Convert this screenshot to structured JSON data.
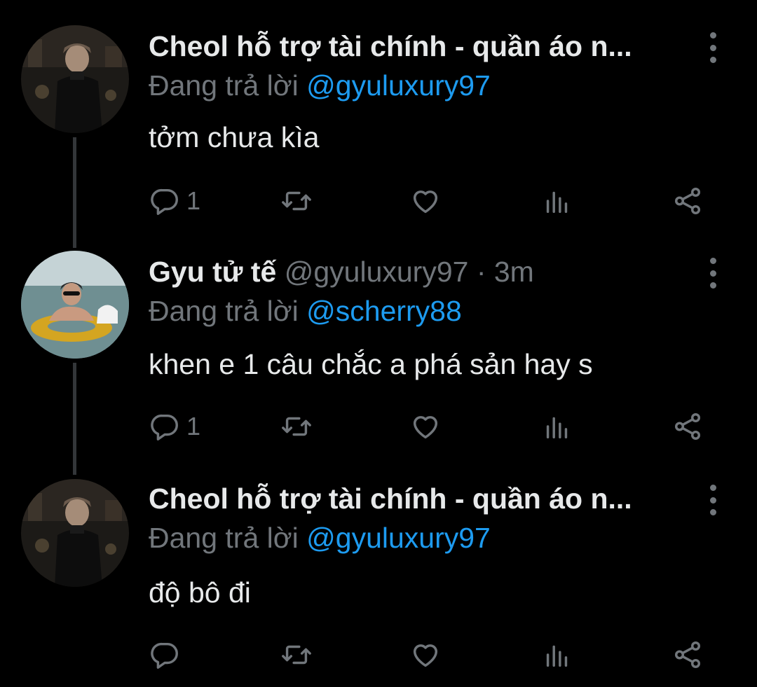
{
  "thread": [
    {
      "display_name": "Cheol hỗ trợ tài chính - quần áo n...",
      "handle": "",
      "meta": "",
      "reply_prefix": "Đang trả lời ",
      "reply_to": "@gyuluxury97",
      "text": "tởm chưa kìa",
      "reply_count": "1",
      "avatar": "dark-restaurant-portrait"
    },
    {
      "display_name": "Gyu tử tế",
      "handle": "@gyuluxury97",
      "meta": " · 3m",
      "reply_prefix": "Đang trả lời ",
      "reply_to": "@scherry88",
      "text": "khen e 1 câu chắc a phá sản hay s",
      "reply_count": "1",
      "avatar": "sea-float-portrait"
    },
    {
      "display_name": "Cheol hỗ trợ tài chính - quần áo n...",
      "handle": "",
      "meta": "",
      "reply_prefix": "Đang trả lời ",
      "reply_to": "@gyuluxury97",
      "text": "độ bô đi",
      "reply_count": "",
      "avatar": "dark-restaurant-portrait"
    }
  ],
  "colors": {
    "background": "#000000",
    "text": "#e7e9ea",
    "muted": "#71767b",
    "mention": "#1d9bf0",
    "thread_line": "#333639"
  },
  "icons": [
    "reply-icon",
    "retweet-icon",
    "like-icon",
    "analytics-icon",
    "share-icon",
    "more-icon"
  ]
}
